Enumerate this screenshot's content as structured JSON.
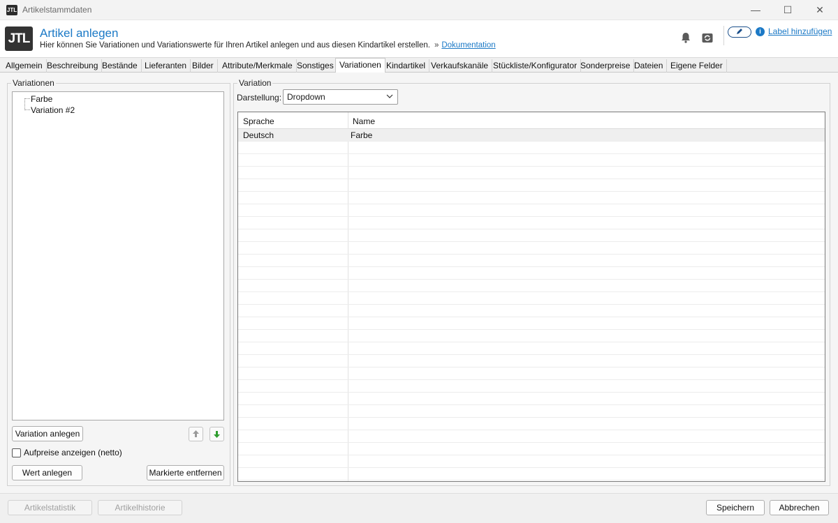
{
  "window": {
    "title": "Artikelstammdaten",
    "app_icon_text": "JTL",
    "minimize_glyph": "—",
    "maximize_glyph": "☐",
    "close_glyph": "✕"
  },
  "header": {
    "logo_text": "JTL",
    "title": "Artikel anlegen",
    "subtitle": "Hier können Sie Variationen und Variationswerte für Ihren Artikel anlegen und aus diesen Kindartikel erstellen.",
    "separator": "»",
    "doc_link": "Dokumentation",
    "label_link": "Label hinzufügen",
    "info_glyph": "i"
  },
  "tabs": [
    {
      "label": "Allgemein"
    },
    {
      "label": "Beschreibung"
    },
    {
      "label": "Bestände"
    },
    {
      "label": "Lieferanten"
    },
    {
      "label": "Bilder"
    },
    {
      "label": "Attribute/Merkmale"
    },
    {
      "label": "Sonstiges"
    },
    {
      "label": "Variationen",
      "active": true
    },
    {
      "label": "Kindartikel"
    },
    {
      "label": "Verkaufskanäle"
    },
    {
      "label": "Stückliste/Konfigurator"
    },
    {
      "label": "Sonderpreise"
    },
    {
      "label": "Dateien"
    },
    {
      "label": "Eigene Felder"
    }
  ],
  "variations_panel": {
    "group_label": "Variationen",
    "tree_items": [
      "Farbe",
      "Variation #2"
    ],
    "add_variation_button": "Variation anlegen",
    "show_surcharges_label": "Aufpreise anzeigen (netto)",
    "show_surcharges_checked": false,
    "add_value_button": "Wert anlegen",
    "remove_selected_button": "Markierte entfernen"
  },
  "variation_panel": {
    "group_label": "Variation",
    "display_label": "Darstellung:",
    "display_value": "Dropdown",
    "table": {
      "columns": [
        "Sprache",
        "Name"
      ],
      "rows": [
        {
          "language": "Deutsch",
          "name": "Farbe"
        }
      ]
    }
  },
  "footer": {
    "stats_button": "Artikelstatistik",
    "history_button": "Artikelhistorie",
    "save_button": "Speichern",
    "cancel_button": "Abbrechen"
  },
  "colors": {
    "accent": "#1b79c6",
    "arrow_up": "#9a9a9a",
    "arrow_down": "#2e9d2e"
  }
}
